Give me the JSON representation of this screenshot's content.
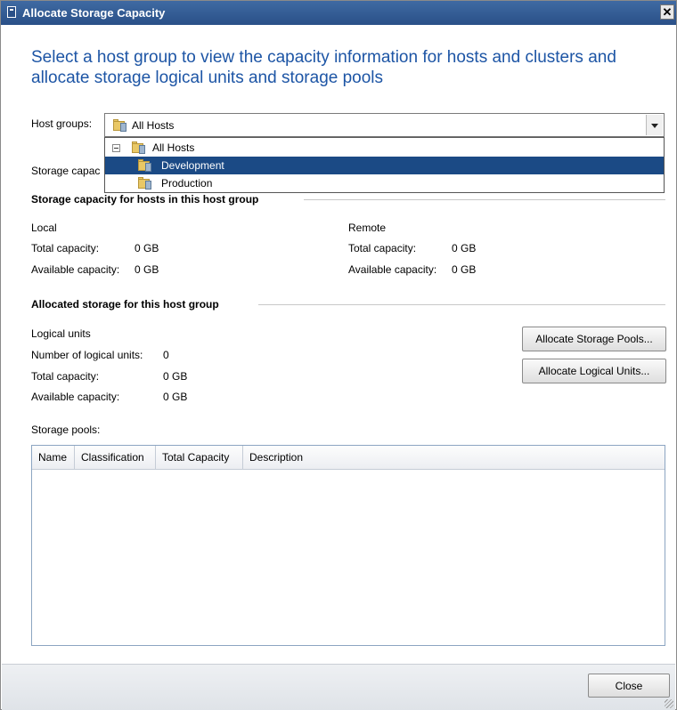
{
  "window": {
    "title": "Allocate Storage Capacity",
    "close_glyph": "✕"
  },
  "heading": "Select a host group to view the capacity information for hosts and clusters and allocate storage logical units and storage pools",
  "host_groups": {
    "label": "Host groups:",
    "selected": "All Hosts",
    "tree": [
      {
        "label": "All Hosts",
        "icon": "folder-icon",
        "expanded": true,
        "selected": false
      },
      {
        "label": "Development",
        "icon": "folder-icon",
        "selected": true
      },
      {
        "label": "Production",
        "icon": "folder-icon",
        "selected": false
      }
    ]
  },
  "storage_capacity_label_partial": "Storage capac",
  "hosts_section": {
    "title": "Storage capacity for hosts in this host group",
    "local": {
      "label": "Local",
      "total_label": "Total capacity:",
      "total_value": "0 GB",
      "available_label": "Available capacity:",
      "available_value": "0 GB"
    },
    "remote": {
      "label": "Remote",
      "total_label": "Total capacity:",
      "total_value": "0 GB",
      "available_label": "Available capacity:",
      "available_value": "0 GB"
    }
  },
  "allocated_section": {
    "title": "Allocated storage for this host group",
    "logical_units_label": "Logical units",
    "number_label": "Number of logical units:",
    "number_value": "0",
    "total_label": "Total capacity:",
    "total_value": "0 GB",
    "available_label": "Available capacity:",
    "available_value": "0 GB",
    "allocate_pools_button": "Allocate Storage Pools...",
    "allocate_units_button": "Allocate Logical Units..."
  },
  "storage_pools": {
    "label": "Storage pools:",
    "columns": [
      "Name",
      "Classification",
      "Total Capacity",
      "Description"
    ],
    "rows": []
  },
  "footer": {
    "close_button": "Close"
  },
  "colors": {
    "title_bar": "#2f5a93",
    "heading": "#1d55a5",
    "selection": "#1b4a85"
  }
}
